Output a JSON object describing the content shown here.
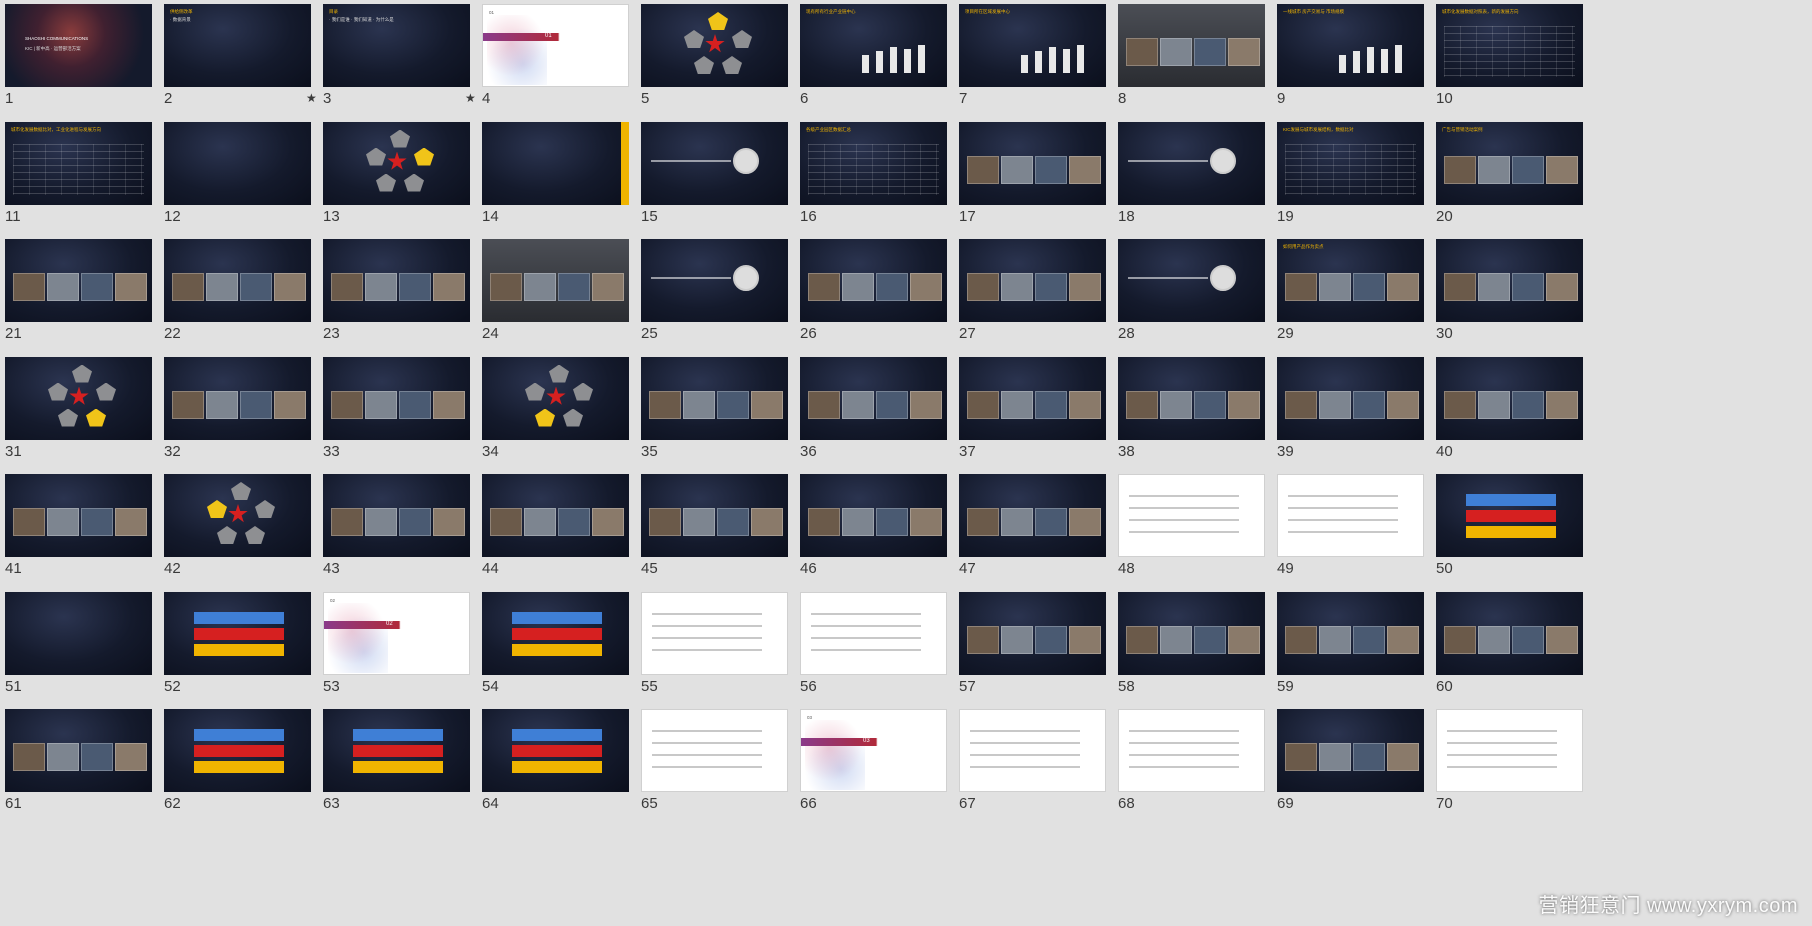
{
  "slides": [
    {
      "n": "1",
      "style": "cover",
      "text": "SHAOSHI COMMUNICATIONS",
      "subtitle": "KIC | 新中高 · 运营部活方案"
    },
    {
      "n": "2",
      "style": "dark",
      "text": "供给侧改革  ",
      "sub": "· 数据背景",
      "starred": true
    },
    {
      "n": "3",
      "style": "dark",
      "text": "目录",
      "sub": "· 我们是谁 · 我们知道 · 为什么是",
      "starred": true
    },
    {
      "n": "4",
      "style": "section",
      "text": "01"
    },
    {
      "n": "5",
      "style": "star",
      "highlight": [
        0
      ]
    },
    {
      "n": "6",
      "style": "dark-chart",
      "text": "现有所有行业产业链中心"
    },
    {
      "n": "7",
      "style": "bars",
      "text": "项目所在区域发展中心"
    },
    {
      "n": "8",
      "style": "gray",
      "text": ""
    },
    {
      "n": "9",
      "style": "bars",
      "text": "一线城市 房产交易与 市场规模"
    },
    {
      "n": "10",
      "style": "table",
      "text": "城市化发展数据对照表，新的发展方向"
    },
    {
      "n": "11",
      "style": "table",
      "text": "城市化发展数据比对，工业化进程与发展方向"
    },
    {
      "n": "12",
      "style": "dark",
      "text": ""
    },
    {
      "n": "13",
      "style": "star",
      "highlight": [
        1
      ]
    },
    {
      "n": "14",
      "style": "map",
      "text": ""
    },
    {
      "n": "15",
      "style": "dark-circle",
      "text": ""
    },
    {
      "n": "16",
      "style": "table",
      "text": "各级产业园区数据汇总"
    },
    {
      "n": "17",
      "style": "photos",
      "text": ""
    },
    {
      "n": "18",
      "style": "dark-circle",
      "text": ""
    },
    {
      "n": "19",
      "style": "table",
      "text": "KIC发展与城市发展结构，数据比对"
    },
    {
      "n": "20",
      "style": "photos",
      "text": "广告与营销活动案例"
    },
    {
      "n": "21",
      "style": "photos",
      "text": ""
    },
    {
      "n": "22",
      "style": "photos",
      "text": ""
    },
    {
      "n": "23",
      "style": "photos",
      "text": ""
    },
    {
      "n": "24",
      "style": "gray",
      "text": ""
    },
    {
      "n": "25",
      "style": "dark-circle",
      "text": ""
    },
    {
      "n": "26",
      "style": "photos",
      "text": ""
    },
    {
      "n": "27",
      "style": "photos",
      "text": ""
    },
    {
      "n": "28",
      "style": "dark-circle",
      "text": ""
    },
    {
      "n": "29",
      "style": "photos",
      "text": "如何用产品作为卖点"
    },
    {
      "n": "30",
      "style": "photos",
      "text": ""
    },
    {
      "n": "31",
      "style": "star",
      "highlight": [
        2
      ]
    },
    {
      "n": "32",
      "style": "photos",
      "text": ""
    },
    {
      "n": "33",
      "style": "photos",
      "text": ""
    },
    {
      "n": "34",
      "style": "star",
      "highlight": [
        3
      ]
    },
    {
      "n": "35",
      "style": "photos",
      "text": ""
    },
    {
      "n": "36",
      "style": "photos",
      "text": ""
    },
    {
      "n": "37",
      "style": "photos",
      "text": ""
    },
    {
      "n": "38",
      "style": "photos",
      "text": ""
    },
    {
      "n": "39",
      "style": "photos",
      "text": ""
    },
    {
      "n": "40",
      "style": "photos",
      "text": ""
    },
    {
      "n": "41",
      "style": "photos",
      "text": ""
    },
    {
      "n": "42",
      "style": "star",
      "highlight": [
        4
      ]
    },
    {
      "n": "43",
      "style": "photos",
      "text": ""
    },
    {
      "n": "44",
      "style": "photos",
      "text": ""
    },
    {
      "n": "45",
      "style": "photos",
      "text": ""
    },
    {
      "n": "46",
      "style": "photos",
      "text": ""
    },
    {
      "n": "47",
      "style": "photos",
      "text": ""
    },
    {
      "n": "48",
      "style": "light",
      "text": ""
    },
    {
      "n": "49",
      "style": "light",
      "text": ""
    },
    {
      "n": "50",
      "style": "dark-boxes",
      "text": ""
    },
    {
      "n": "51",
      "style": "dark",
      "text": ""
    },
    {
      "n": "52",
      "style": "dark-boxes",
      "text": ""
    },
    {
      "n": "53",
      "style": "section",
      "text": "02"
    },
    {
      "n": "54",
      "style": "dark-boxes",
      "text": ""
    },
    {
      "n": "55",
      "style": "light",
      "text": ""
    },
    {
      "n": "56",
      "style": "light",
      "text": ""
    },
    {
      "n": "57",
      "style": "photos",
      "text": ""
    },
    {
      "n": "58",
      "style": "photos",
      "text": ""
    },
    {
      "n": "59",
      "style": "photos",
      "text": ""
    },
    {
      "n": "60",
      "style": "photos",
      "text": ""
    },
    {
      "n": "61",
      "style": "photos",
      "text": ""
    },
    {
      "n": "62",
      "style": "dark-boxes",
      "text": ""
    },
    {
      "n": "63",
      "style": "dark-boxes",
      "text": ""
    },
    {
      "n": "64",
      "style": "dark-boxes",
      "text": ""
    },
    {
      "n": "65",
      "style": "light",
      "text": ""
    },
    {
      "n": "66",
      "style": "section",
      "text": "03"
    },
    {
      "n": "67",
      "style": "light",
      "text": ""
    },
    {
      "n": "68",
      "style": "light",
      "text": ""
    },
    {
      "n": "69",
      "style": "photos",
      "text": ""
    },
    {
      "n": "70",
      "style": "light",
      "text": ""
    }
  ],
  "star_glyph": "★",
  "watermark": "营销狂意门 www.yxrym.com"
}
